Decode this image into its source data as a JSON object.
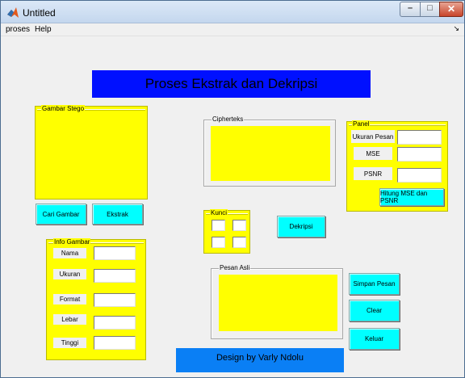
{
  "window": {
    "title": "Untitled"
  },
  "menu": {
    "items": [
      "proses",
      "Help"
    ]
  },
  "banner": {
    "title": "Proses Ekstrak dan Dekripsi"
  },
  "gambar_stego": {
    "title": "Gambar Stego"
  },
  "buttons": {
    "cari_gambar": "Cari Gambar",
    "ekstrak": "Ekstrak",
    "dekripsi": "Dekripsi",
    "hitung": "Hitung MSE dan PSNR",
    "simpan": "Simpan Pesan",
    "clear": "Clear",
    "keluar": "Keluar"
  },
  "info_gambar": {
    "title": "Info Gambar",
    "labels": [
      "Nama",
      "Ukuran",
      "Format",
      "Lebar",
      "Tinggi"
    ]
  },
  "cipherteks": {
    "title": "Cipherteks"
  },
  "kunci": {
    "title": "Kunci"
  },
  "panel": {
    "title": "Panel",
    "labels": [
      "Ukuran Pesan",
      "MSE",
      "PSNR"
    ]
  },
  "pesan_asli": {
    "title": "Pesan Asli"
  },
  "footer": {
    "text": "Design by Varly Ndolu"
  },
  "colors": {
    "yellow": "#ffff00",
    "cyan": "#00ffff",
    "blue": "#0010ff",
    "footer_blue": "#0a7ff5"
  }
}
